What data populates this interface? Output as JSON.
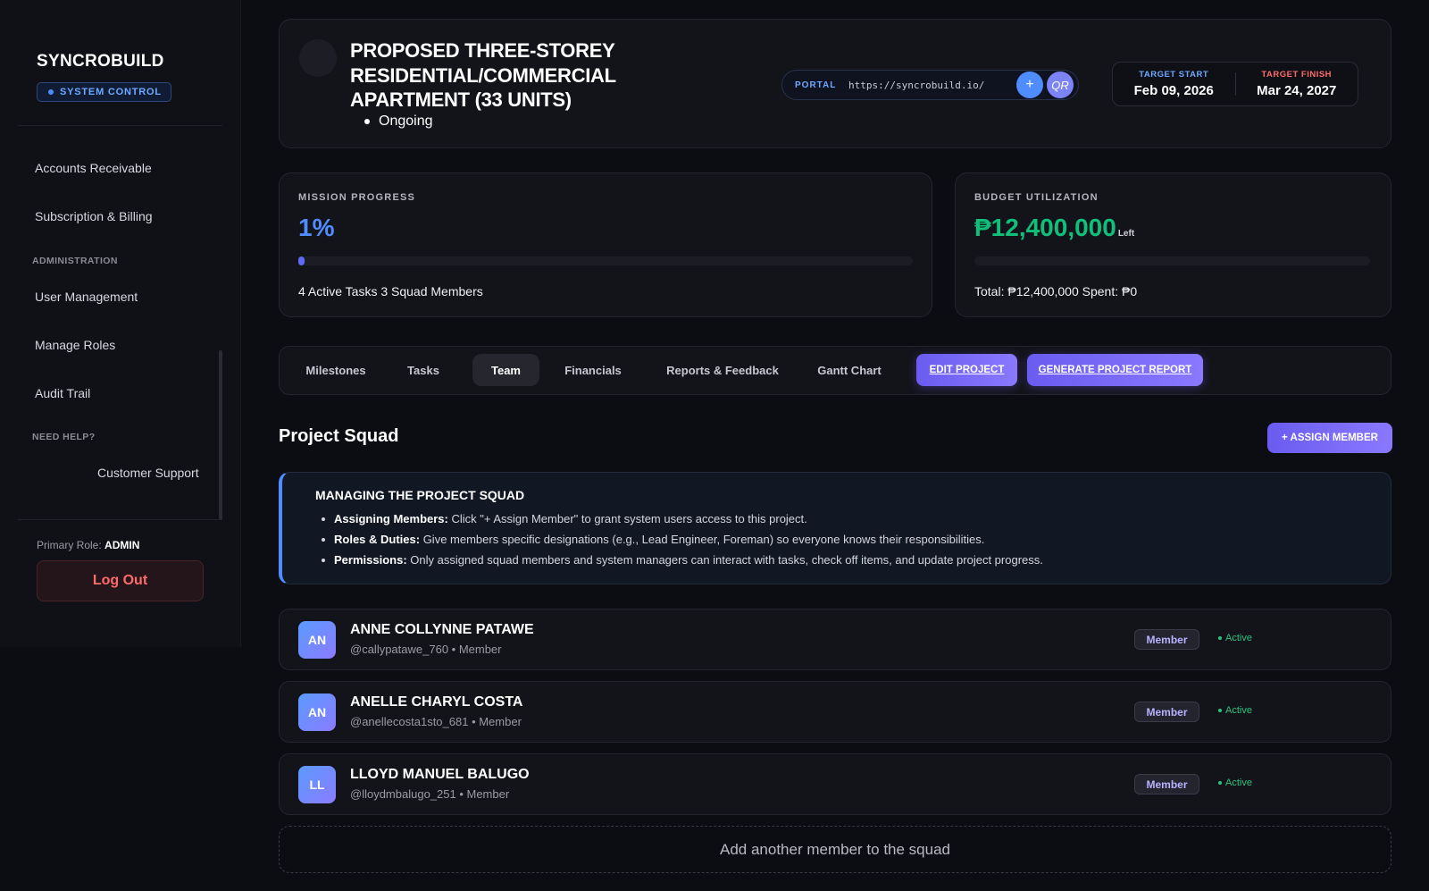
{
  "sidebar": {
    "brand": "SYNCROBUILD",
    "badge": "SYSTEM CONTROL",
    "items": {
      "accounts_receivable": "Accounts Receivable",
      "subscription_billing": "Subscription & Billing",
      "user_management": "User Management",
      "manage_roles": "Manage Roles",
      "audit_trail": "Audit Trail",
      "customer_support": "Customer Support"
    },
    "headings": {
      "administration": "ADMINISTRATION",
      "need_help": "NEED HELP?"
    },
    "role_label": "Primary Role:",
    "role_value": "ADMIN",
    "logout": "Log Out"
  },
  "project": {
    "title": "PROPOSED THREE-STOREY RESIDENTIAL/COMMERCIAL APARTMENT (33 UNITS)",
    "status": "Ongoing",
    "portal_label": "PORTAL",
    "portal_url": "https://syncrobuild.io/",
    "plus_icon": "+",
    "qr_label": "QR",
    "target_start_label": "TARGET START",
    "target_start": "Feb 09, 2026",
    "target_finish_label": "TARGET FINISH",
    "target_finish": "Mar 24, 2027",
    "colors": {
      "start_label": "#6ea8ff",
      "finish_label": "#ff6b6b"
    }
  },
  "progress": {
    "label": "MISSION PROGRESS",
    "value": "1%",
    "fraction": 0.01,
    "foot": "4 Active Tasks 3 Squad Members",
    "color": "#4f8cff"
  },
  "budget": {
    "label": "BUDGET UTILIZATION",
    "value": "₱12,400,000",
    "suffix": "Left",
    "fraction": 0,
    "foot": "Total: ₱12,400,000 Spent: ₱0",
    "color": "#10c07a"
  },
  "tabs": {
    "milestones": "Milestones",
    "tasks": "Tasks",
    "team": "Team",
    "financials": "Financials",
    "reports": "Reports & Feedback",
    "gantt": "Gantt Chart",
    "edit": "EDIT PROJECT",
    "report": "GENERATE PROJECT REPORT"
  },
  "squad": {
    "title": "Project Squad",
    "assign_button": "+ ASSIGN MEMBER",
    "info_title": "MANAGING THE PROJECT SQUAD",
    "info": [
      {
        "bold": "Assigning Members:",
        "text": " Click \"+ Assign Member\" to grant system users access to this project."
      },
      {
        "bold": "Roles & Duties:",
        "text": " Give members specific designations (e.g., Lead Engineer, Foreman) so everyone knows their responsibilities."
      },
      {
        "bold": "Permissions:",
        "text": " Only assigned squad members and system managers can interact with tasks, check off items, and update project progress."
      }
    ],
    "members": [
      {
        "initials": "AN",
        "name": "ANNE COLLYNNE PATAWE",
        "handle": "@callypatawe_760 • Member",
        "role": "Member",
        "status": "Active"
      },
      {
        "initials": "AN",
        "name": "ANELLE CHARYL COSTA",
        "handle": "@anellecosta1sto_681 • Member",
        "role": "Member",
        "status": "Active"
      },
      {
        "initials": "LL",
        "name": "LLOYD MANUEL BALUGO",
        "handle": "@lloydmbalugo_251 • Member",
        "role": "Member",
        "status": "Active"
      }
    ],
    "add_member": "Add another member to the squad"
  }
}
